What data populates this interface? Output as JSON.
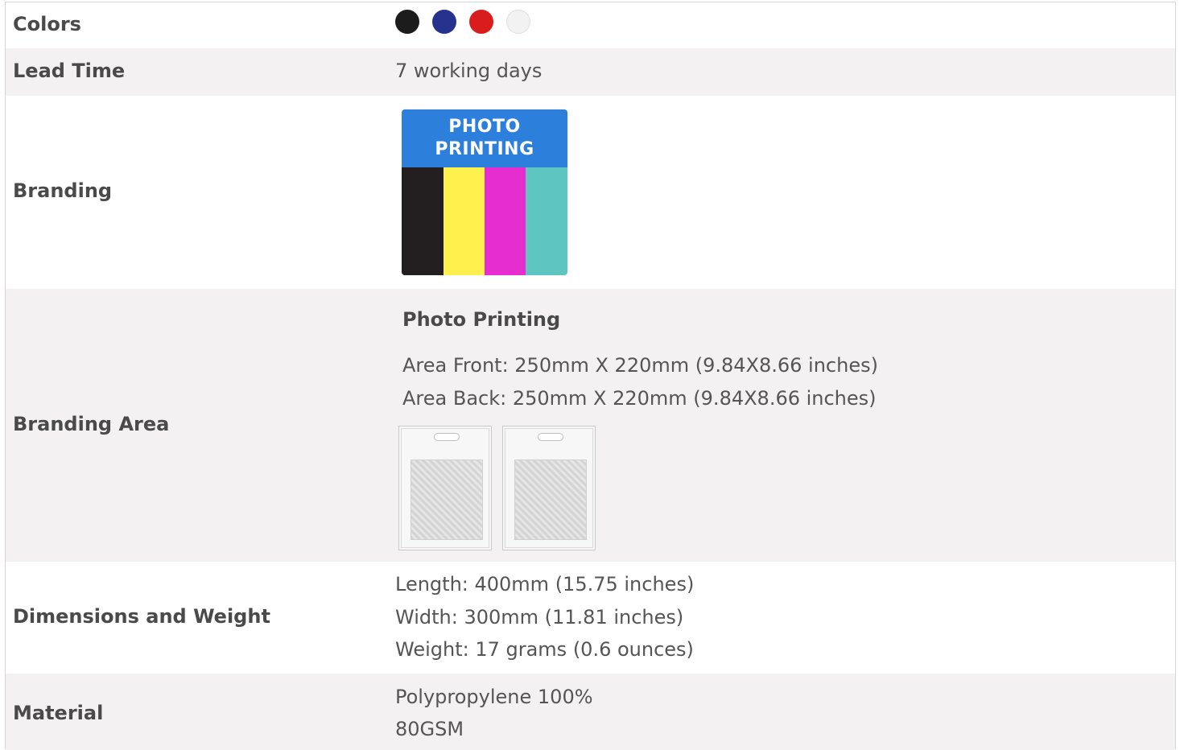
{
  "rows": {
    "colors": {
      "label": "Colors",
      "swatches": [
        {
          "name": "black",
          "hex": "#1c1c1c"
        },
        {
          "name": "navy-blue",
          "hex": "#25338f"
        },
        {
          "name": "red",
          "hex": "#d91c1c"
        },
        {
          "name": "white",
          "hex": "#f2f2f2"
        }
      ]
    },
    "lead_time": {
      "label": "Lead Time",
      "value": "7 working days"
    },
    "branding": {
      "label": "Branding",
      "logo": {
        "line1": "PHOTO",
        "line2": "PRINTING",
        "header_color": "#2d7fdc",
        "stripe_colors": [
          "#231f20",
          "#fff04d",
          "#e62dcf",
          "#5ec5c0"
        ]
      }
    },
    "branding_area": {
      "label": "Branding Area",
      "method": "Photo Printing",
      "area_front": "Area Front: 250mm X 220mm (9.84X8.66 inches)",
      "area_back": "Area Back: 250mm X 220mm (9.84X8.66 inches)",
      "bag_icons": [
        "bag-front-icon",
        "bag-back-icon"
      ]
    },
    "dimensions": {
      "label": "Dimensions and Weight",
      "length": "Length: 400mm (15.75 inches)",
      "width": "Width: 300mm (11.81 inches)",
      "weight": "Weight: 17 grams (0.6 ounces)"
    },
    "material": {
      "label": "Material",
      "line1": "Polypropylene 100%",
      "line2": "80GSM"
    }
  },
  "colors": {
    "row_alt_background": "#f3f1f2",
    "label_text": "#4a4a4a",
    "value_text": "#555555",
    "border": "#d6d6d6"
  }
}
